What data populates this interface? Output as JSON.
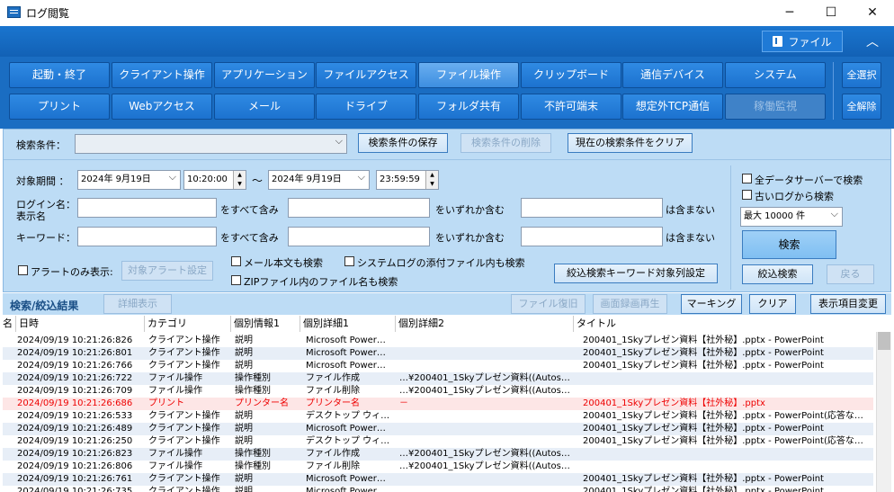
{
  "window": {
    "title": "ログ閲覧",
    "minimize": "─",
    "maximize": "☐",
    "close": "✕"
  },
  "topbar": {
    "file_label": "ファイル",
    "collapse": "︿"
  },
  "categories": {
    "row1": [
      "起動・終了",
      "クライアント操作",
      "アプリケーション",
      "ファイルアクセス",
      "ファイル操作",
      "クリップボード",
      "通信デバイス",
      "システム"
    ],
    "row2": [
      "プリント",
      "Webアクセス",
      "メール",
      "ドライブ",
      "フォルダ共有",
      "不許可端末",
      "想定外TCP通信",
      "稼働監視"
    ],
    "select_all": "全選択",
    "clear_all": "全解除"
  },
  "search": {
    "condition_label": "検索条件：",
    "condition_value": "",
    "save": "検索条件の保存",
    "delete": "検索条件の削除",
    "clear": "現在の検索条件をクリア",
    "period_label": "対象期間 ：",
    "date_from": "2024年 9月19日",
    "time_from": "10:20:00",
    "tilde": "～",
    "date_to": "2024年 9月19日",
    "time_to": "23:59:59",
    "login_label1": "ログイン名：",
    "login_label2": "表示名",
    "keyword_label": "キーワード：",
    "all_contains": "をすべて含み",
    "any_contains": "をいずれか含む",
    "not_contains": "は含まない",
    "alert_only": "アラートのみ表示:",
    "alert_setting": "対象アラート設定",
    "mail_body": "メール本文も検索",
    "syslog_attach": "システムログの添付ファイル内も検索",
    "zip_names": "ZIPファイル内のファイル名も検索",
    "narrow_columns": "絞込検索キーワード対象列設定",
    "all_servers": "全データサーバーで検索",
    "old_logs": "古いログから検索",
    "max_count": "最大 10000 件",
    "search_btn": "検索",
    "narrow_btn": "絞込検索",
    "back_btn": "戻る"
  },
  "results": {
    "title": "検索/絞込結果",
    "detail": "詳細表示",
    "file_restore": "ファイル復旧",
    "screen_play": "画面録画再生",
    "marking": "マーキング",
    "clear": "クリア",
    "columns": "表示項目変更"
  },
  "table": {
    "headers": [
      "名",
      "日時",
      "カテゴリ",
      "個別情報1",
      "個別詳細1",
      "個別詳細2",
      "タイトル"
    ],
    "rows": [
      {
        "dt": "2024/09/19 10:21:26:826",
        "cat": "クライアント操作",
        "i1": "説明",
        "d1": "Microsoft Power…",
        "d2": "",
        "t": "200401_1Skyプレゼン資料【社外秘】.pptx - PowerPoint"
      },
      {
        "dt": "2024/09/19 10:21:26:801",
        "cat": "クライアント操作",
        "i1": "説明",
        "d1": "Microsoft Power…",
        "d2": "",
        "t": "200401_1Skyプレゼン資料【社外秘】.pptx - PowerPoint"
      },
      {
        "dt": "2024/09/19 10:21:26:766",
        "cat": "クライアント操作",
        "i1": "説明",
        "d1": "Microsoft Power…",
        "d2": "",
        "t": "200401_1Skyプレゼン資料【社外秘】.pptx - PowerPoint"
      },
      {
        "dt": "2024/09/19 10:21:26:722",
        "cat": "ファイル操作",
        "i1": "操作種別",
        "d1": "ファイル作成",
        "d2": "…¥200401_1Skyプレゼン資料((Autos…",
        "t": ""
      },
      {
        "dt": "2024/09/19 10:21:26:709",
        "cat": "ファイル操作",
        "i1": "操作種別",
        "d1": "ファイル削除",
        "d2": "…¥200401_1Skyプレゼン資料((Autos…",
        "t": ""
      },
      {
        "dt": "2024/09/19 10:21:26:686",
        "cat": "プリント",
        "i1": "プリンター名",
        "d1": "プリンター名",
        "d2": "－",
        "t": "200401_1Skyプレゼン資料【社外秘】.pptx",
        "red": true
      },
      {
        "dt": "2024/09/19 10:21:26:533",
        "cat": "クライアント操作",
        "i1": "説明",
        "d1": "デスクトップ ウィ…",
        "d2": "",
        "t": "200401_1Skyプレゼン資料【社外秘】.pptx - PowerPoint(応答な…"
      },
      {
        "dt": "2024/09/19 10:21:26:489",
        "cat": "クライアント操作",
        "i1": "説明",
        "d1": "Microsoft Power…",
        "d2": "",
        "t": "200401_1Skyプレゼン資料【社外秘】.pptx - PowerPoint"
      },
      {
        "dt": "2024/09/19 10:21:26:250",
        "cat": "クライアント操作",
        "i1": "説明",
        "d1": "デスクトップ ウィ…",
        "d2": "",
        "t": "200401_1Skyプレゼン資料【社外秘】.pptx - PowerPoint(応答な…"
      },
      {
        "dt": "2024/09/19 10:21:26:823",
        "cat": "ファイル操作",
        "i1": "操作種別",
        "d1": "ファイル作成",
        "d2": "…¥200401_1Skyプレゼン資料((Autos…",
        "t": ""
      },
      {
        "dt": "2024/09/19 10:21:26:806",
        "cat": "ファイル操作",
        "i1": "操作種別",
        "d1": "ファイル削除",
        "d2": "…¥200401_1Skyプレゼン資料((Autos…",
        "t": ""
      },
      {
        "dt": "2024/09/19 10:21:26:761",
        "cat": "クライアント操作",
        "i1": "説明",
        "d1": "Microsoft Power…",
        "d2": "",
        "t": "200401_1Skyプレゼン資料【社外秘】.pptx - PowerPoint"
      },
      {
        "dt": "2024/09/19 10:21:26:735",
        "cat": "クライアント操作",
        "i1": "説明",
        "d1": "Microsoft Power…",
        "d2": "",
        "t": "200401_1Skyプレゼン資料【社外秘】.pptx - PowerPoint"
      }
    ]
  }
}
